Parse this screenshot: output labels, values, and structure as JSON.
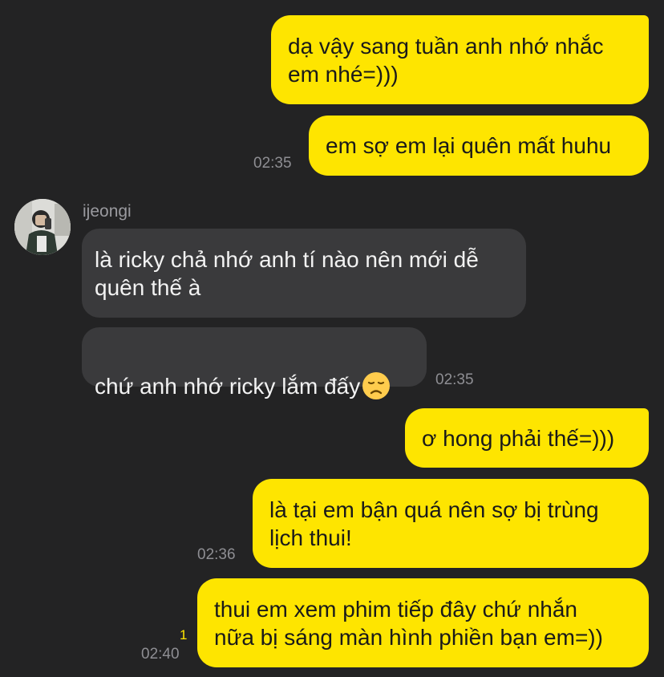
{
  "contact": {
    "name": "ijeongi",
    "avatar_icon": "profile-photo-avatar"
  },
  "colors": {
    "background": "#232324",
    "outgoing_bubble": "#FEE500",
    "incoming_bubble": "#3A3A3C",
    "timestamp": "#8E8E93",
    "unread_count": "#FEE500"
  },
  "messages": [
    {
      "direction": "outgoing",
      "text": "dạ vậy sang tuần anh nhớ nhắc\nem nhé=)))"
    },
    {
      "direction": "outgoing",
      "text": "em sợ em lại quên mất huhu",
      "time": "02:35"
    },
    {
      "direction": "incoming",
      "sender": "ijeongi",
      "text": "là ricky chả nhớ anh tí nào nên mới dễ\nquên thế à"
    },
    {
      "direction": "incoming",
      "text": "chứ anh nhớ ricky lắm đấy",
      "emoji": "disappointed-face-icon",
      "time": "02:35"
    },
    {
      "direction": "outgoing",
      "text": "ơ hong phải thế=)))"
    },
    {
      "direction": "outgoing",
      "text": "là tại em bận quá nên sợ bị trùng\nlịch thui!",
      "time": "02:36"
    },
    {
      "direction": "outgoing",
      "text": "thui em xem phim tiếp đây chứ nhắn\nnữa bị sáng màn hình phiền bạn em=))",
      "time": "02:40",
      "unread": "1"
    }
  ]
}
